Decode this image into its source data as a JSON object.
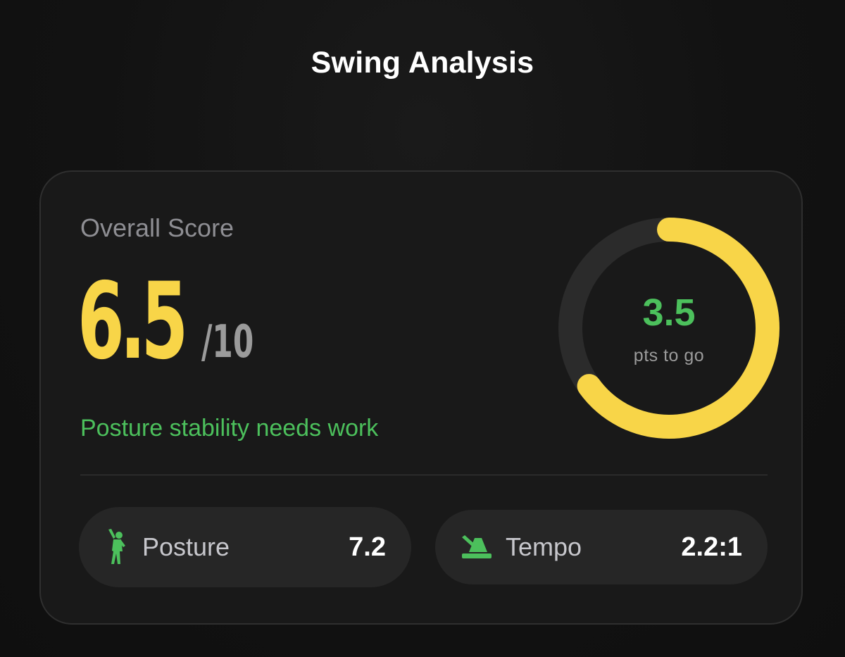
{
  "header": {
    "title": "Swing Analysis"
  },
  "score_card": {
    "label": "Overall Score",
    "score": "6.5",
    "score_max": "/10",
    "feedback": "Posture stability needs work",
    "ring": {
      "value": "3.5",
      "caption": "pts to go",
      "progress_fraction": 0.65
    }
  },
  "metrics": [
    {
      "icon": "golfer-icon",
      "label": "Posture",
      "value": "7.2"
    },
    {
      "icon": "metronome-icon",
      "label": "Tempo",
      "value": "2.2:1"
    }
  ],
  "colors": {
    "accent_yellow": "#f8d548",
    "accent_green": "#4cc05c",
    "ring_track": "#2b2b2b",
    "card_background": "#191919",
    "pill_background": "#262626"
  }
}
